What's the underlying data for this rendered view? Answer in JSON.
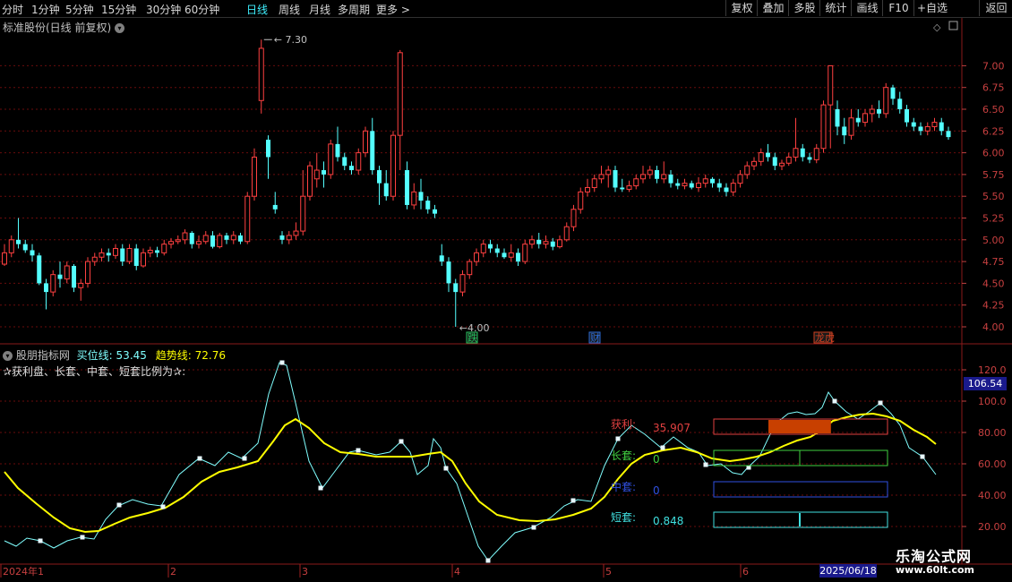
{
  "toolbar": {
    "periods": [
      "分时",
      "1分钟",
      "5分钟",
      "15分钟",
      "30分钟",
      "60分钟",
      "日线",
      "周线",
      "月线",
      "多周期",
      "更多"
    ],
    "active_period": "日线",
    "right_buttons": [
      "复权",
      "叠加",
      "多股",
      "统计",
      "画线",
      "F10",
      "+自选",
      "返回"
    ]
  },
  "main_panel": {
    "title": "标准股份(日线 前复权)",
    "high_label": "7.30",
    "low_label": "4.00",
    "markers": [
      {
        "label": "跌",
        "color": "#22c05a"
      },
      {
        "label": "财",
        "color": "#2c6cd8"
      },
      {
        "label": "龙虎",
        "color": "#d04020"
      }
    ],
    "y_ticks": [
      "7.00",
      "6.75",
      "6.50",
      "6.25",
      "6.00",
      "5.75",
      "5.50",
      "5.25",
      "5.00",
      "4.75",
      "4.50",
      "4.25",
      "4.00"
    ]
  },
  "indicator_panel": {
    "name": "股朋指标网",
    "buy_label": "买位线:",
    "buy_value": "53.45",
    "trend_label": "趋势线:",
    "trend_value": "72.76",
    "description": "✰获利盘、长套、中套、短套比例为✰:",
    "y_ticks": [
      "120.0",
      "100.0",
      "80.00",
      "60.00",
      "40.00",
      "20.00"
    ],
    "current_price_label": "106.54",
    "legend": [
      {
        "label": "获利:",
        "value": "35.907",
        "color": "#e04040",
        "fill": 0.36
      },
      {
        "label": "长套:",
        "value": "0",
        "color": "#40d040",
        "fill": 0
      },
      {
        "label": "中套:",
        "value": "0",
        "color": "#3050e0",
        "fill": 0
      },
      {
        "label": "短套:",
        "value": "0.848",
        "color": "#40e0e0",
        "fill": 0.01
      }
    ]
  },
  "x_axis": {
    "labels": [
      "2024年1",
      "2",
      "3",
      "4",
      "5",
      "6"
    ],
    "cursor_date": "2025/06/18"
  },
  "watermark": {
    "title": "乐淘公式网",
    "url": "www.60lt.com"
  },
  "colors": {
    "up": "#ff4040",
    "down": "#54ffff",
    "trend": "#ffff00",
    "buy": "#80ffff",
    "grid": "#7a1010"
  }
}
